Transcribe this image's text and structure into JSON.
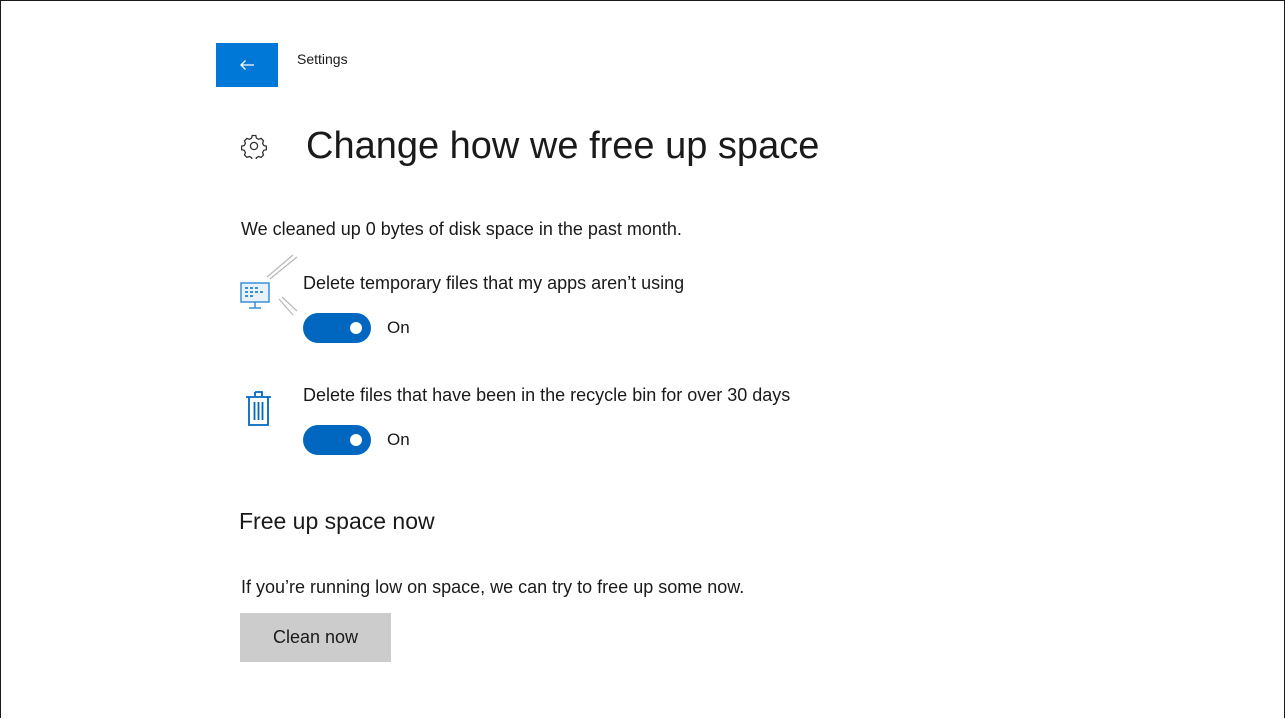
{
  "header": {
    "back_icon": "back-arrow-icon",
    "app_title": "Settings"
  },
  "page": {
    "icon": "gear-icon",
    "title": "Change how we free up space",
    "summary": "We cleaned up 0 bytes of disk space in the past month."
  },
  "options": [
    {
      "icon": "temporary-files-icon",
      "label": "Delete temporary files that my apps aren’t using",
      "state": "On",
      "enabled": true
    },
    {
      "icon": "recycle-bin-icon",
      "label": "Delete files that have been in the recycle bin for over 30 days",
      "state": "On",
      "enabled": true
    }
  ],
  "free_up": {
    "title": "Free up space now",
    "description": "If you’re running low on space, we can try to free up some now.",
    "button_label": "Clean now"
  },
  "colors": {
    "accent": "#0078d7",
    "toggle_on": "#0067c0",
    "button_bg": "#cccccc"
  }
}
